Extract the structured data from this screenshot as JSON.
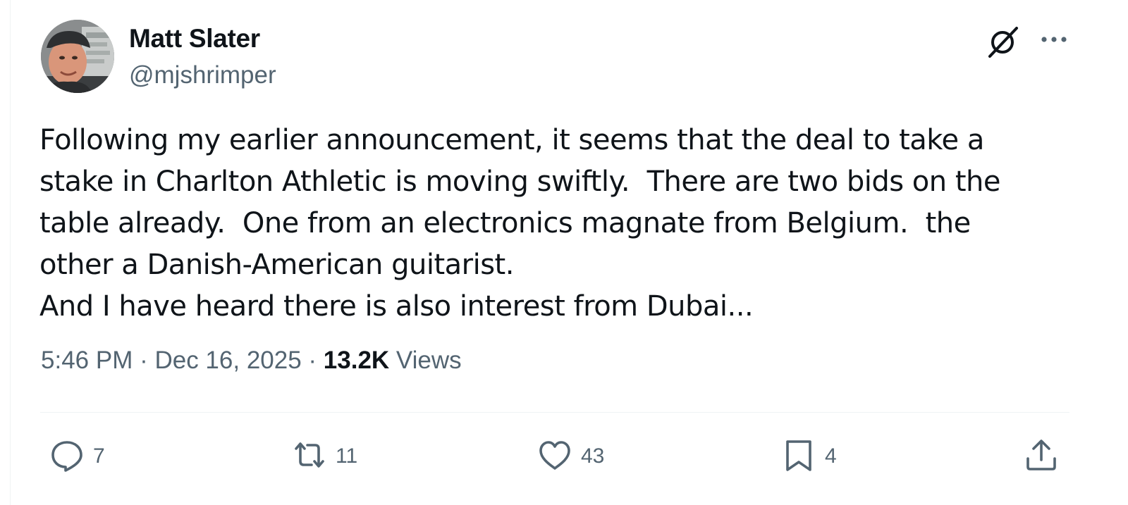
{
  "author": {
    "name": "Matt Slater",
    "handle": "@mjshrimper"
  },
  "tweet": {
    "lines": [
      "Following my earlier announcement, it seems that the deal to take a",
      "stake in Charlton Athletic is moving swiftly.  There are two bids on the",
      "table already.  One from an electronics magnate from Belgium.  the",
      "other a Danish-American guitarist.",
      "And I have heard there is also interest from Dubai..."
    ]
  },
  "meta": {
    "time": "5:46 PM",
    "separator": " · ",
    "date": "Dec 16, 2025",
    "views_count": "13.2K",
    "views_label": " Views"
  },
  "actions": {
    "replies": "7",
    "reposts": "11",
    "likes": "43",
    "bookmarks": "4"
  },
  "icons": {
    "grok": "grok-icon",
    "more": "more-icon",
    "reply": "reply-icon",
    "repost": "repost-icon",
    "like": "heart-icon",
    "bookmark": "bookmark-icon",
    "share": "share-icon"
  },
  "colors": {
    "text_primary": "#0f1419",
    "text_secondary": "#536471",
    "divider": "#eff3f4"
  }
}
